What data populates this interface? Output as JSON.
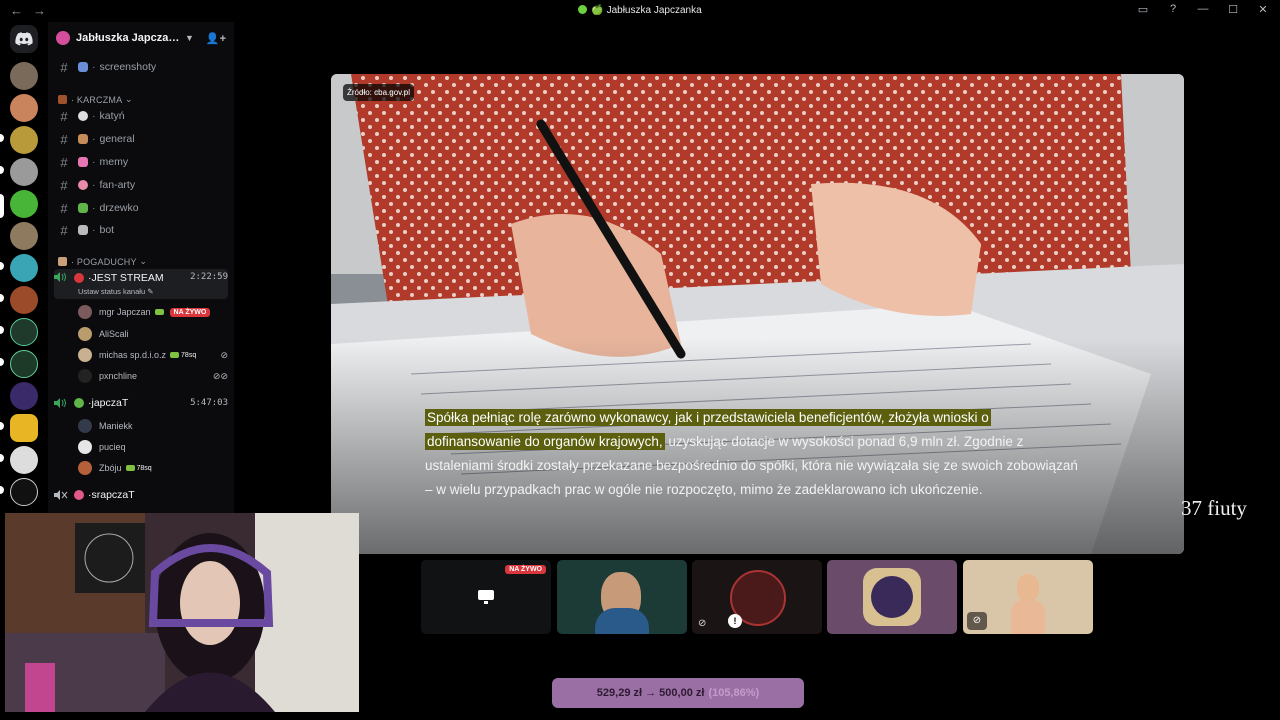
{
  "window": {
    "title": "🍏 Jabłuszka Japczanka",
    "back": "←",
    "forward": "→"
  },
  "guild": {
    "name": "Jabłuszka Japcza…"
  },
  "channels_top": [
    {
      "name": "screenshoty"
    }
  ],
  "categories": [
    {
      "name": "KARCZMA"
    },
    {
      "name": "POGADUCHY"
    }
  ],
  "karczma_channels": [
    {
      "name": "katyń"
    },
    {
      "name": "general"
    },
    {
      "name": "memy"
    },
    {
      "name": "fan-arty"
    },
    {
      "name": "drzewko"
    },
    {
      "name": "bot"
    }
  ],
  "voice_channels": [
    {
      "name": "JEST STREAM",
      "time": "2:22:59",
      "status_hint": "Ustaw status kanału",
      "members": [
        {
          "name": "mgr Japczan",
          "live": "NA ŻYWO"
        },
        {
          "name": "AliScali"
        },
        {
          "name": "michas sp.d.i.o.z",
          "tag": "78sq"
        },
        {
          "name": "pxnchline"
        }
      ]
    },
    {
      "name": "japczaT",
      "time": "5:47:03",
      "members": [
        {
          "name": "Maniekk"
        },
        {
          "name": "pucieq"
        },
        {
          "name": "Zbóju",
          "tag": "78sq"
        }
      ]
    },
    {
      "name": "srapczaT"
    }
  ],
  "stage": {
    "source_label": "Źródło: cba.gov.pl",
    "caption_highlight_1": "Spółka pełniąc rolę zarówno wykonawcy, jak i przedstawiciela beneficjentów, złożyła wnioski o",
    "caption_highlight_2": "dofinansowanie do organów krajowych,",
    "caption_rest": " uzyskując dotacje w wysokości ponad 6,9 mln zł. Zgodnie z ustaleniami środki zostały przekazane bezpośrednio do spółki, która nie wywiązała się ze swoich zobowiązań – w wielu przypadkach prac w ogóle nie rozpoczęto, mimo że zadeklarowano ich ukończenie."
  },
  "overlay_text": "37 fiuty",
  "tiles": {
    "live_badge": "NA ŻYWO"
  },
  "donation": {
    "text": "529,29 zł → 500,00 zł",
    "percent": "(105,86%)"
  },
  "colors": {
    "live_red": "#da373c",
    "caption_highlight": "#5b5f0e",
    "donation_bar": "#9a6fa4"
  }
}
